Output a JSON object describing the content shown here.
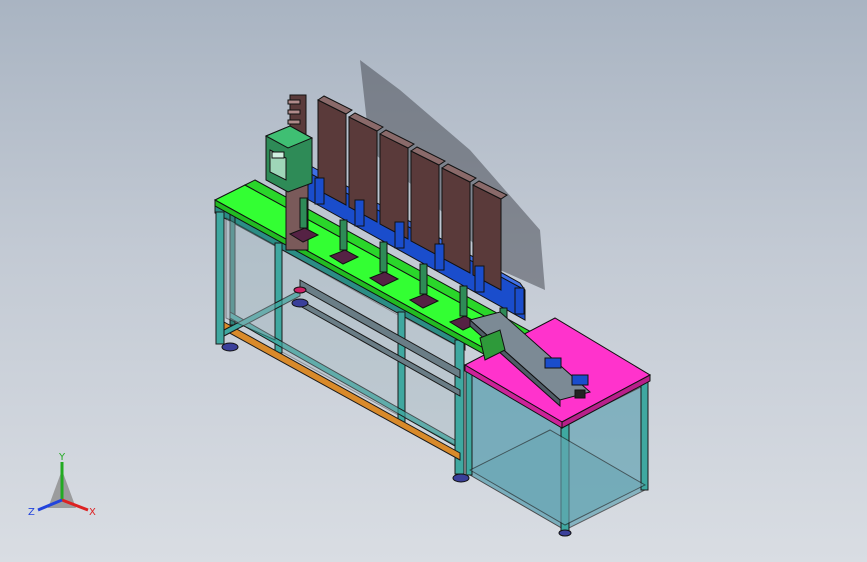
{
  "viewport": {
    "background_top": "#a9b4c2",
    "background_bottom": "#d9dde3"
  },
  "model": {
    "frame_color": "#3fa8a0",
    "main_table_color": "#33ff33",
    "side_table_color": "#ff33cc",
    "panel_color": "#1a4dcc",
    "cabinet_color": "#5a3a3a",
    "control_box_color": "#2e8b57",
    "glass_color": "#4a8fa0",
    "station_count": 6
  },
  "triad": {
    "x_label": "X",
    "y_label": "Y",
    "z_label": "Z",
    "x_color": "#dd2222",
    "y_color": "#22aa22",
    "z_color": "#2244dd"
  }
}
